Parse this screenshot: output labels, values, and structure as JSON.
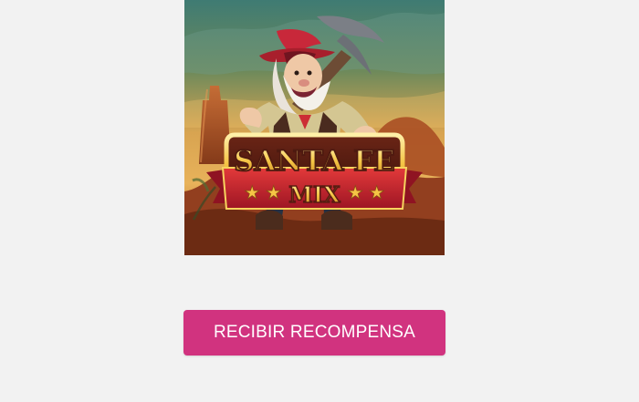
{
  "game": {
    "logo_title": "SANTA FE",
    "logo_subtitle": "MIX",
    "logo_stars": "★ ★",
    "colors": {
      "sky_top": "#3f7b73",
      "sky_mid": "#d8a451",
      "ground": "#8a3f1f",
      "hat": "#c8283a",
      "banner": "#c91f2e",
      "logo_text": "#f4c544"
    },
    "image_description_icon": "gold-miner-character-icon"
  },
  "cta": {
    "label": "RECIBIR RECOMPENSA",
    "color": "#d1337f"
  }
}
